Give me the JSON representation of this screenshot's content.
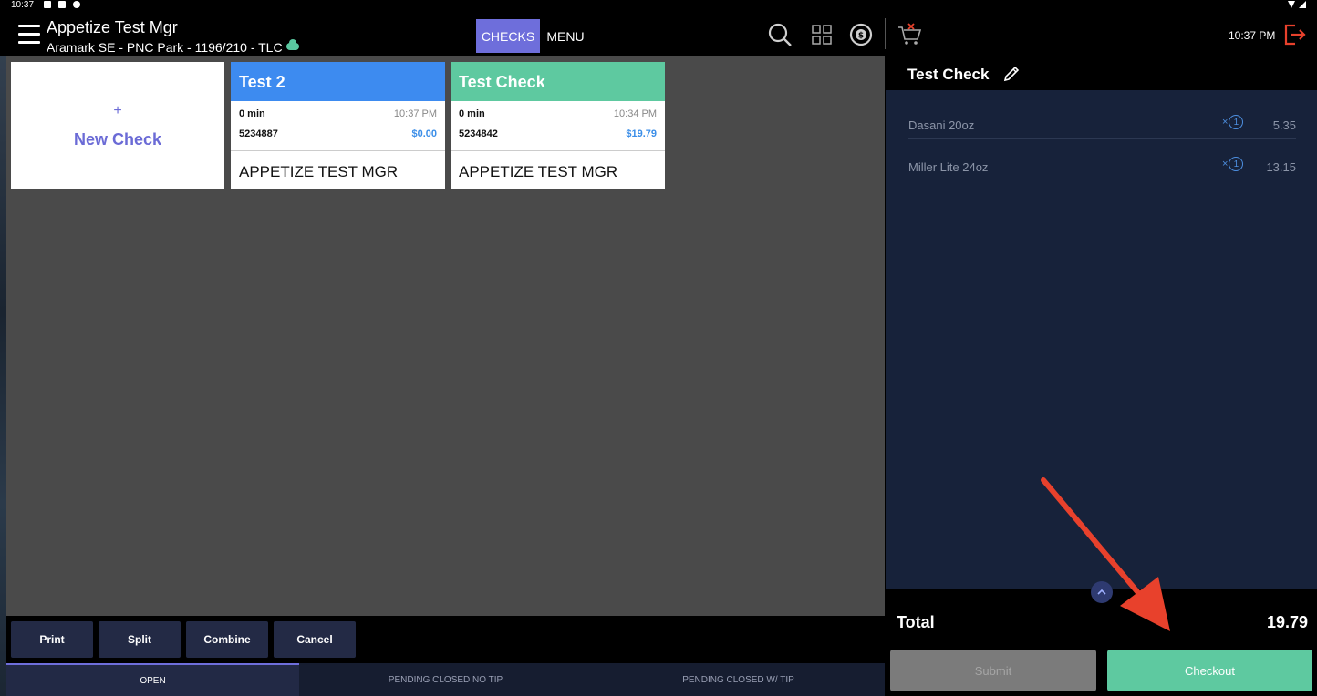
{
  "statusbar": {
    "time": "10:37"
  },
  "header": {
    "title": "Appetize Test Mgr",
    "subtitle": "Aramark SE - PNC Park - 1196/210 - TLC",
    "tabs": [
      {
        "label": "CHECKS",
        "active": true
      },
      {
        "label": "MENU",
        "active": false
      }
    ],
    "clock": "10:37 PM",
    "icons": [
      "search-icon",
      "grid-icon",
      "currency-icon",
      "cart-clear-icon",
      "logout-icon"
    ]
  },
  "checks": {
    "new_check": {
      "plus": "+",
      "label": "New Check"
    },
    "cards": [
      {
        "title": "Test 2",
        "color": "#3d8bf0",
        "elapsed": "0 min",
        "time": "10:37 PM",
        "number": "5234887",
        "amount": "$0.00",
        "owner": "APPETIZE TEST MGR"
      },
      {
        "title": "Test Check",
        "color": "#5ec9a0",
        "elapsed": "0 min",
        "time": "10:34 PM",
        "number": "5234842",
        "amount": "$19.79",
        "owner": "APPETIZE TEST MGR"
      }
    ]
  },
  "actions": [
    "Print",
    "Split",
    "Combine",
    "Cancel"
  ],
  "bottom_tabs": [
    {
      "label": "OPEN",
      "active": true
    },
    {
      "label": "PENDING CLOSED NO TIP",
      "active": false
    },
    {
      "label": "PENDING CLOSED W/ TIP",
      "active": false
    }
  ],
  "order": {
    "title": "Test Check",
    "items": [
      {
        "name": "Dasani 20oz",
        "qty_prefix": "×",
        "qty": "1",
        "price": "5.35"
      },
      {
        "name": "Miller Lite 24oz",
        "qty_prefix": "×",
        "qty": "1",
        "price": "13.15"
      }
    ],
    "total_label": "Total",
    "total_value": "19.79",
    "submit_label": "Submit",
    "checkout_label": "Checkout"
  },
  "colors": {
    "accent": "#6e6edb",
    "checkout": "#5ec9a0",
    "annotation_arrow": "#e8412c"
  }
}
